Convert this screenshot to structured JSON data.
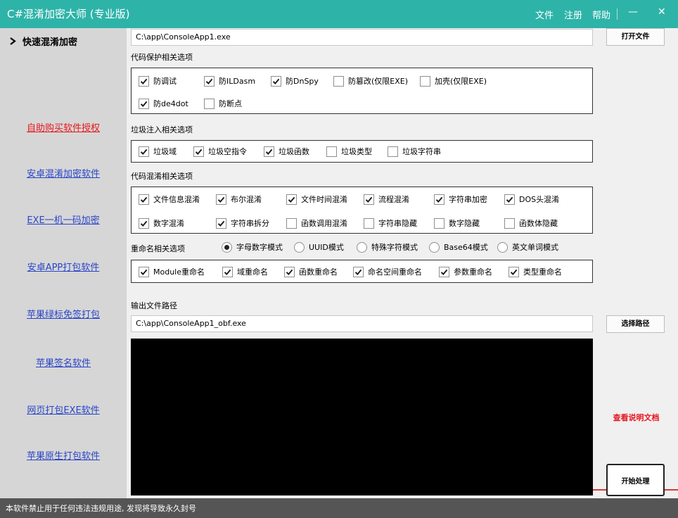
{
  "app": {
    "title": "C#混淆加密大师 (专业版)",
    "menu": [
      "文件",
      "注册",
      "帮助"
    ],
    "minimize": "—",
    "close": "✕"
  },
  "sidebar": {
    "header": "快速混淆加密",
    "links": [
      {
        "label": "自助购买软件授权",
        "color": "#e8161e"
      },
      {
        "label": "安卓混淆加密软件",
        "color": "#2a45c9"
      },
      {
        "label": "EXE一机一码加密",
        "color": "#2a45c9"
      },
      {
        "label": "安卓APP打包软件",
        "color": "#2a45c9"
      },
      {
        "label": "苹果绿标免签打包",
        "color": "#2a45c9"
      },
      {
        "label": "苹果签名软件",
        "color": "#2a45c9"
      },
      {
        "label": "网页打包EXE软件",
        "color": "#2a45c9"
      },
      {
        "label": "苹果原生打包软件",
        "color": "#2a45c9"
      }
    ]
  },
  "input_file": {
    "value": "C:\\app\\ConsoleApp1.exe",
    "button": "打开文件"
  },
  "protection": {
    "label": "代码保护相关选项",
    "options": [
      {
        "label": "防调试",
        "checked": true
      },
      {
        "label": "防ILDasm",
        "checked": true
      },
      {
        "label": "防DnSpy",
        "checked": true
      },
      {
        "label": "防篡改(仅限EXE)",
        "checked": false
      },
      {
        "label": "加壳(仅限EXE)",
        "checked": false
      },
      {
        "label": "防de4dot",
        "checked": true
      },
      {
        "label": "防断点",
        "checked": false
      }
    ]
  },
  "junk": {
    "label": "垃圾注入相关选项",
    "options": [
      {
        "label": "垃圾域",
        "checked": true
      },
      {
        "label": "垃圾空指令",
        "checked": true
      },
      {
        "label": "垃圾函数",
        "checked": true
      },
      {
        "label": "垃圾类型",
        "checked": false
      },
      {
        "label": "垃圾字符串",
        "checked": false
      }
    ]
  },
  "obfuscation": {
    "label": "代码混淆相关选项",
    "options": [
      {
        "label": "文件信息混淆",
        "checked": true
      },
      {
        "label": "布尔混淆",
        "checked": true
      },
      {
        "label": "文件时间混淆",
        "checked": true
      },
      {
        "label": "流程混淆",
        "checked": true
      },
      {
        "label": "字符串加密",
        "checked": true
      },
      {
        "label": "DOS头混淆",
        "checked": true
      },
      {
        "label": "数字混淆",
        "checked": true
      },
      {
        "label": "字符串拆分",
        "checked": true
      },
      {
        "label": "函数调用混淆",
        "checked": false
      },
      {
        "label": "字符串隐藏",
        "checked": false
      },
      {
        "label": "数字隐藏",
        "checked": false
      },
      {
        "label": "函数体隐藏",
        "checked": false
      }
    ]
  },
  "rename": {
    "label": "重命名相关选项",
    "modes": [
      {
        "label": "字母数字模式",
        "selected": true
      },
      {
        "label": "UUID模式",
        "selected": false
      },
      {
        "label": "特殊字符模式",
        "selected": false
      },
      {
        "label": "Base64模式",
        "selected": false
      },
      {
        "label": "英文单词模式",
        "selected": false
      }
    ],
    "options": [
      {
        "label": "Module重命名",
        "checked": true
      },
      {
        "label": "域重命名",
        "checked": true
      },
      {
        "label": "函数重命名",
        "checked": true
      },
      {
        "label": "命名空间重命名",
        "checked": true
      },
      {
        "label": "参数重命名",
        "checked": true
      },
      {
        "label": "类型重命名",
        "checked": true
      }
    ]
  },
  "output_path": {
    "label": "输出文件路径",
    "value": "C:\\app\\ConsoleApp1_obf.exe",
    "button": "选择路径"
  },
  "doc_link": "查看说明文档",
  "start_button": "开始处理",
  "status": "本软件禁止用于任何违法违规用途, 发现将导致永久封号"
}
